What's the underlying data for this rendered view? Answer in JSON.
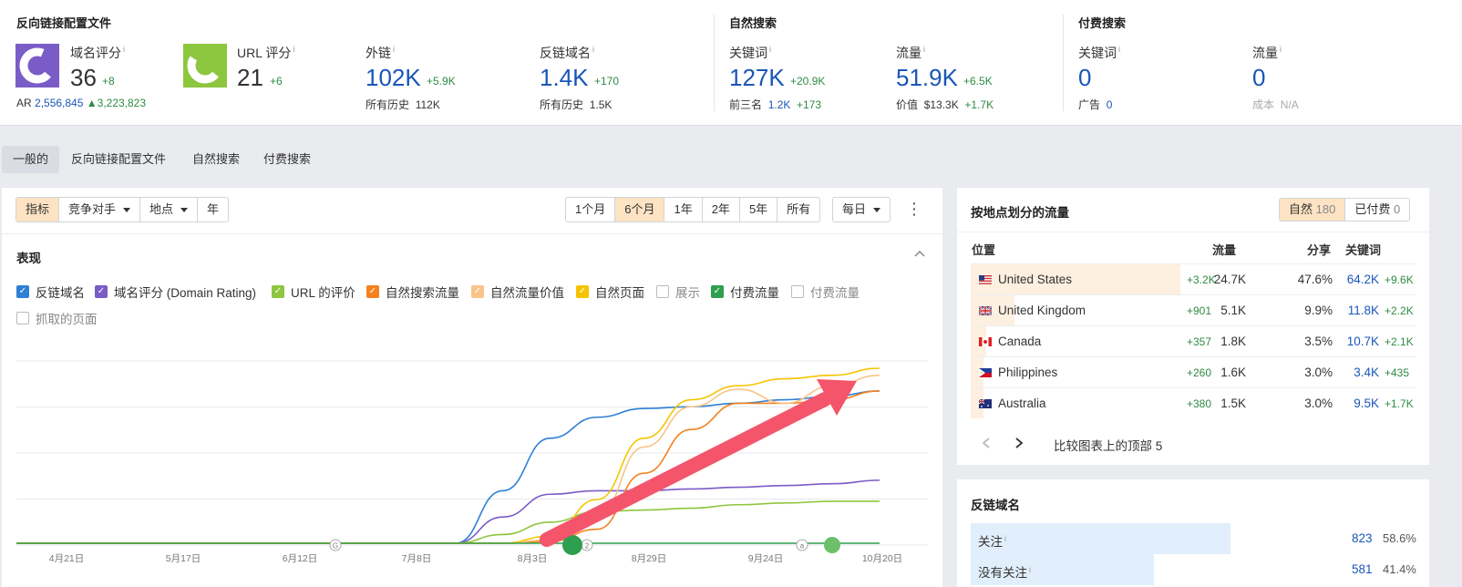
{
  "overview": {
    "backlink_profile": {
      "title": "反向链接配置文件",
      "dr": {
        "label": "域名评分",
        "value": "36",
        "delta": "+8"
      },
      "ar": {
        "label": "AR",
        "value": "2,556,845",
        "delta": "3,223,823"
      },
      "ur": {
        "label": "URL 评分",
        "value": "21",
        "delta": "+6"
      },
      "backlinks": {
        "label": "外链",
        "value": "102K",
        "delta": "+5.9K",
        "sub_label": "所有历史",
        "sub_value": "112K"
      },
      "ref_domains": {
        "label": "反链域名",
        "value": "1.4K",
        "delta": "+170",
        "sub_label": "所有历史",
        "sub_value": "1.5K"
      }
    },
    "organic": {
      "title": "自然搜索",
      "keywords": {
        "label": "关键词",
        "value": "127K",
        "delta": "+20.9K",
        "sub_label": "前三名",
        "sub_value": "1.2K",
        "sub_delta": "+173"
      },
      "traffic": {
        "label": "流量",
        "value": "51.9K",
        "delta": "+6.5K",
        "sub_label": "价值",
        "sub_value": "$13.3K",
        "sub_delta": "+1.7K"
      }
    },
    "paid": {
      "title": "付费搜索",
      "keywords": {
        "label": "关键词",
        "value": "0",
        "sub_label": "广告",
        "sub_value": "0"
      },
      "traffic": {
        "label": "流量",
        "value": "0",
        "sub_label": "成本",
        "sub_value": "N/A"
      }
    },
    "info_glyph": "i"
  },
  "tabs": [
    "一般的",
    "反向链接配置文件",
    "自然搜索",
    "付费搜索"
  ],
  "toolbar": {
    "mode": [
      "指标",
      "竞争对手",
      "地点",
      "年"
    ],
    "ranges": [
      "1个月",
      "6个月",
      "1年",
      "2年",
      "5年",
      "所有"
    ],
    "interval": "每日",
    "more": "⋮"
  },
  "performance": {
    "title": "表现",
    "legend": [
      {
        "label": "反链域名",
        "checked": true,
        "color": "#2f7fd6"
      },
      {
        "label": "域名评分 (Domain Rating)",
        "checked": true,
        "color": "#7a5cc7"
      },
      {
        "label": "URL 的评价",
        "checked": true,
        "color": "#8dc63f"
      },
      {
        "label": "自然搜索流量",
        "checked": true,
        "color": "#f5821f"
      },
      {
        "label": "自然流量价值",
        "checked": true,
        "color": "#f9c48a"
      },
      {
        "label": "自然页面",
        "checked": true,
        "color": "#f5c400"
      },
      {
        "label": "展示",
        "checked": false,
        "color": "#bbbbbb"
      },
      {
        "label": "付费流量",
        "checked": true,
        "color": "#2e9e4f"
      },
      {
        "label": "付费流量",
        "checked": false,
        "color": "#bbbbbb"
      },
      {
        "label": "抓取的页面",
        "checked": false,
        "color": "#bbbbbb"
      }
    ],
    "markers": [
      "G",
      "2",
      "a"
    ]
  },
  "chart_data": {
    "type": "line",
    "x_ticks": [
      "4月21日",
      "5月17日",
      "6月12日",
      "7月8日",
      "8月3日",
      "8月29日",
      "9月24日",
      "10月20日"
    ],
    "grid": true,
    "series": [
      {
        "name": "反链域名",
        "color": "#2f7fd6",
        "values": [
          0,
          0,
          0,
          0,
          0,
          0.3,
          0.6,
          0.72,
          0.77,
          0.78,
          0.8,
          0.82,
          0.84,
          0.87
        ]
      },
      {
        "name": "域名评分 (Domain Rating)",
        "color": "#7a5cc7",
        "values": [
          0,
          0,
          0,
          0,
          0,
          0.15,
          0.28,
          0.3,
          0.3,
          0.31,
          0.32,
          0.33,
          0.34,
          0.36
        ]
      },
      {
        "name": "URL 的评价",
        "color": "#8dc63f",
        "values": [
          0,
          0,
          0,
          0,
          0,
          0.05,
          0.12,
          0.18,
          0.19,
          0.2,
          0.22,
          0.23,
          0.24,
          0.24
        ]
      },
      {
        "name": "自然搜索流量",
        "color": "#f5821f",
        "values": [
          0,
          0,
          0,
          0,
          0,
          0,
          0.01,
          0.08,
          0.4,
          0.65,
          0.8,
          0.8,
          0.82,
          0.87
        ]
      },
      {
        "name": "自然流量价值",
        "color": "#f9c48a",
        "values": [
          0,
          0,
          0,
          0,
          0,
          0,
          0.02,
          0.15,
          0.55,
          0.78,
          0.88,
          0.8,
          0.9,
          0.96
        ]
      },
      {
        "name": "自然页面",
        "color": "#f5c400",
        "values": [
          0,
          0,
          0,
          0,
          0,
          0,
          0.04,
          0.25,
          0.6,
          0.82,
          0.9,
          0.94,
          0.96,
          1.0
        ]
      },
      {
        "name": "付费流量",
        "color": "#2e9e4f",
        "values": [
          0,
          0,
          0,
          0,
          0,
          0,
          0,
          0,
          0,
          0,
          0,
          0,
          0,
          0
        ]
      }
    ]
  },
  "countries": {
    "title": "按地点划分的流量",
    "toggle_organic": "自然",
    "toggle_organic_count": "180",
    "toggle_paid": "已付费",
    "toggle_paid_count": "0",
    "headers": [
      "位置",
      "流量",
      "分享",
      "关键词"
    ],
    "rows": [
      {
        "name": "United States",
        "traffic": "24.7K",
        "traffic_delta": "+3.2K",
        "share": "47.6%",
        "keywords": "64.2K",
        "kw_delta": "+9.6K",
        "share_frac": 0.476,
        "flag": "us"
      },
      {
        "name": "United Kingdom",
        "traffic": "5.1K",
        "traffic_delta": "+901",
        "share": "9.9%",
        "keywords": "11.8K",
        "kw_delta": "+2.2K",
        "share_frac": 0.099,
        "flag": "uk"
      },
      {
        "name": "Canada",
        "traffic": "1.8K",
        "traffic_delta": "+357",
        "share": "3.5%",
        "keywords": "10.7K",
        "kw_delta": "+2.1K",
        "share_frac": 0.035,
        "flag": "ca"
      },
      {
        "name": "Philippines",
        "traffic": "1.6K",
        "traffic_delta": "+260",
        "share": "3.0%",
        "keywords": "3.4K",
        "kw_delta": "+435",
        "share_frac": 0.03,
        "flag": "ph"
      },
      {
        "name": "Australia",
        "traffic": "1.5K",
        "traffic_delta": "+380",
        "share": "3.0%",
        "keywords": "9.5K",
        "kw_delta": "+1.7K",
        "share_frac": 0.03,
        "flag": "au"
      }
    ],
    "compare_label": "比较图表上的顶部 5"
  },
  "ref_domains_panel": {
    "title": "反链域名",
    "rows": [
      {
        "label": "关注",
        "value": "823",
        "pct": "58.6%",
        "frac": 0.586
      },
      {
        "label": "没有关注",
        "value": "581",
        "pct": "41.4%",
        "frac": 0.414
      }
    ]
  }
}
